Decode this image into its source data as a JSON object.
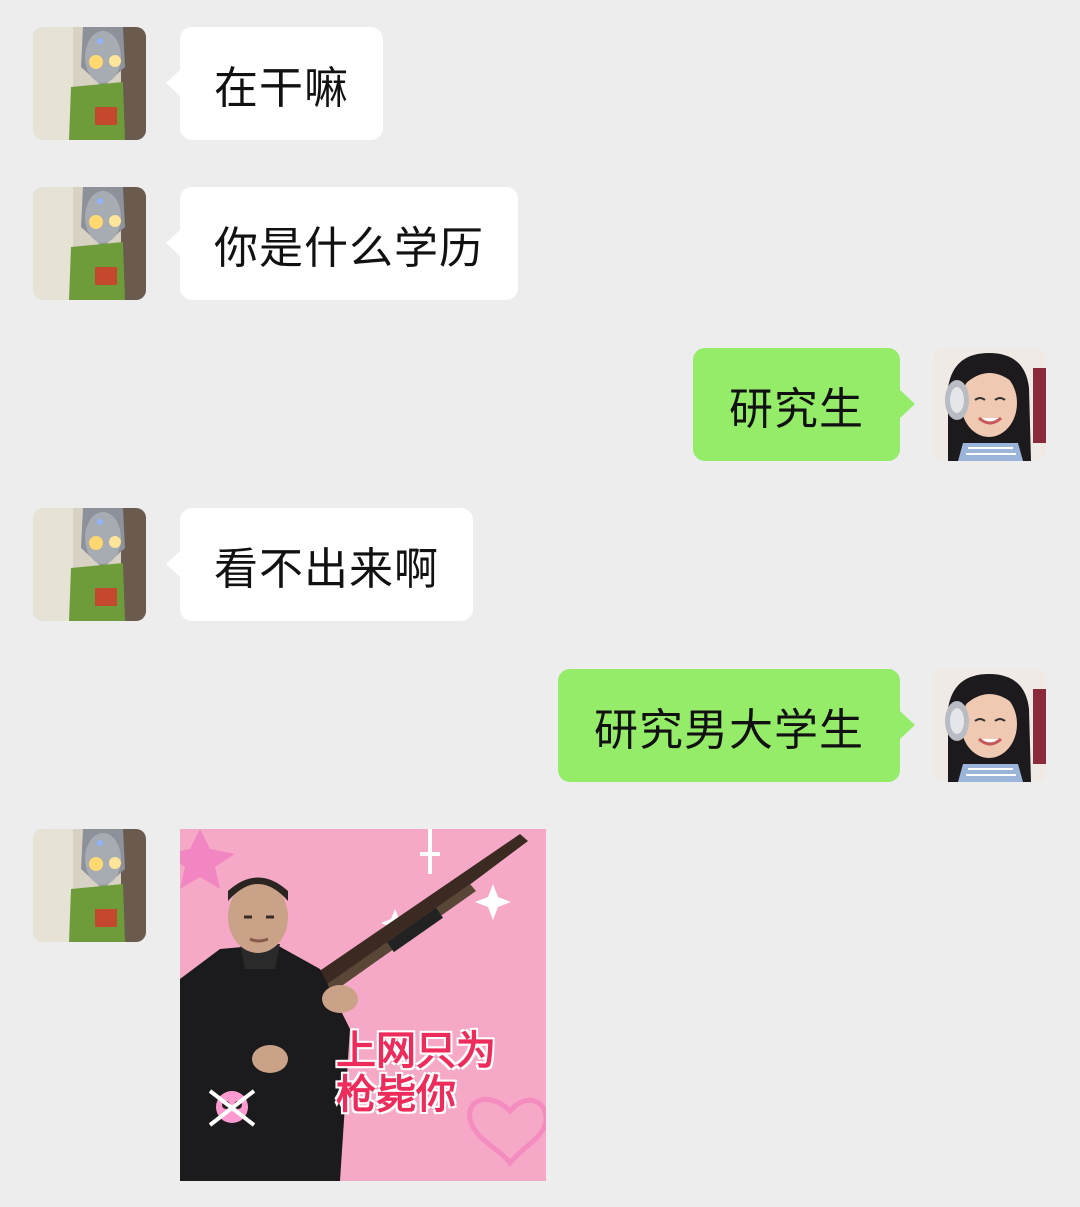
{
  "messages": [
    {
      "side": "left",
      "type": "text",
      "text": "在干嘛"
    },
    {
      "side": "left",
      "type": "text",
      "text": "你是什么学历"
    },
    {
      "side": "right",
      "type": "text",
      "text": "研究生"
    },
    {
      "side": "left",
      "type": "text",
      "text": "看不出来啊"
    },
    {
      "side": "right",
      "type": "text",
      "text": "研究男大学生"
    },
    {
      "side": "left",
      "type": "sticker",
      "caption_line1": "上网只为",
      "caption_line2": "枪毙你"
    }
  ],
  "colors": {
    "background": "#ededed",
    "incoming_bubble": "#ffffff",
    "outgoing_bubble": "#95ec69",
    "sticker_background": "#f6a9c6",
    "sticker_caption": "#ee2c5b"
  },
  "icons": {
    "left_avatar": "ultraman-photo-avatar",
    "right_avatar": "girl-with-headphones-avatar",
    "sticker": "man-with-rifle-meme-sticker"
  }
}
